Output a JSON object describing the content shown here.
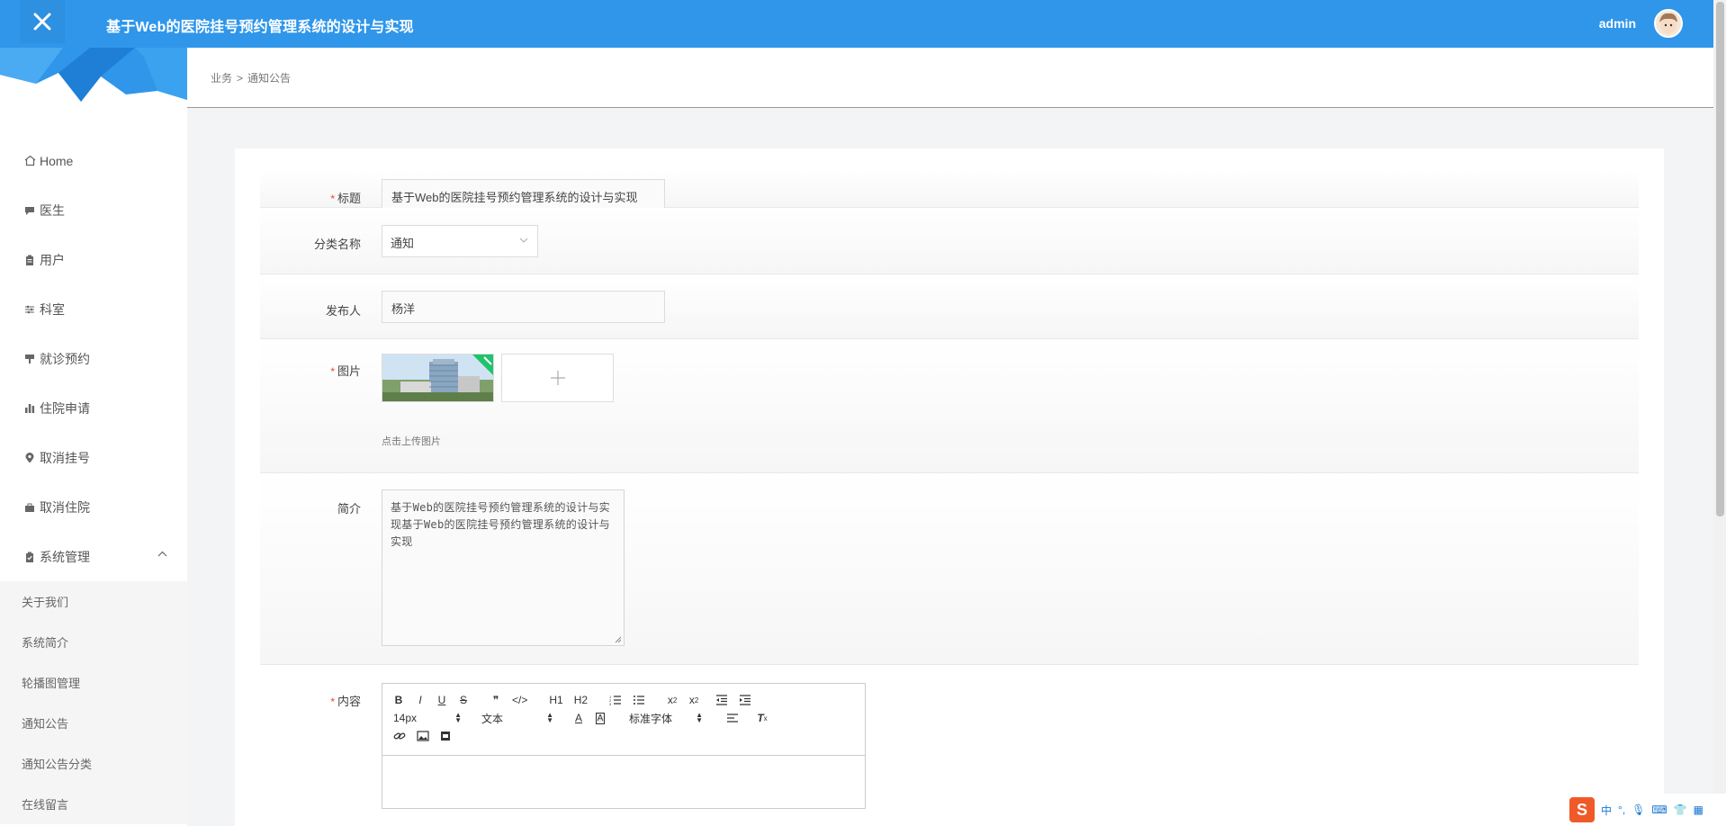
{
  "header": {
    "app_title": "基于Web的医院挂号预约管理系统的设计与实现",
    "user_name": "admin"
  },
  "breadcrumb": {
    "parent": "业务",
    "separator": ">",
    "current": "通知公告"
  },
  "sidebar": {
    "items": [
      {
        "label": "Home",
        "icon": "home-icon"
      },
      {
        "label": "医生",
        "icon": "comment-icon"
      },
      {
        "label": "用户",
        "icon": "clipboard-icon"
      },
      {
        "label": "科室",
        "icon": "sliders-icon"
      },
      {
        "label": "就诊预约",
        "icon": "flag-icon"
      },
      {
        "label": "住院申请",
        "icon": "bar-chart-icon"
      },
      {
        "label": "取消挂号",
        "icon": "location-pin-icon"
      },
      {
        "label": "取消住院",
        "icon": "briefcase-icon"
      },
      {
        "label": "系统管理",
        "icon": "clipboard-check-icon"
      }
    ],
    "submenu": [
      "关于我们",
      "系统简介",
      "轮播图管理",
      "通知公告",
      "通知公告分类",
      "在线留言"
    ]
  },
  "form": {
    "title_label": "标题",
    "title_value": "基于Web的医院挂号预约管理系统的设计与实现",
    "category_label": "分类名称",
    "category_value": "通知",
    "publisher_label": "发布人",
    "publisher_value": "杨洋",
    "image_label": "图片",
    "image_hint": "点击上传图片",
    "intro_label": "简介",
    "intro_value": "基于Web的医院挂号预约管理系统的设计与实现基于Web的医院挂号预约管理系统的设计与实现",
    "content_label": "内容",
    "required_mark": "*"
  },
  "editor": {
    "font_size": "14px",
    "block_type": "文本",
    "font_family": "标准字体",
    "h1": "H1",
    "h2": "H2"
  },
  "ime": {
    "lang": "中"
  },
  "colors": {
    "header_bg": "#2f96ea",
    "required": "#f04040"
  }
}
